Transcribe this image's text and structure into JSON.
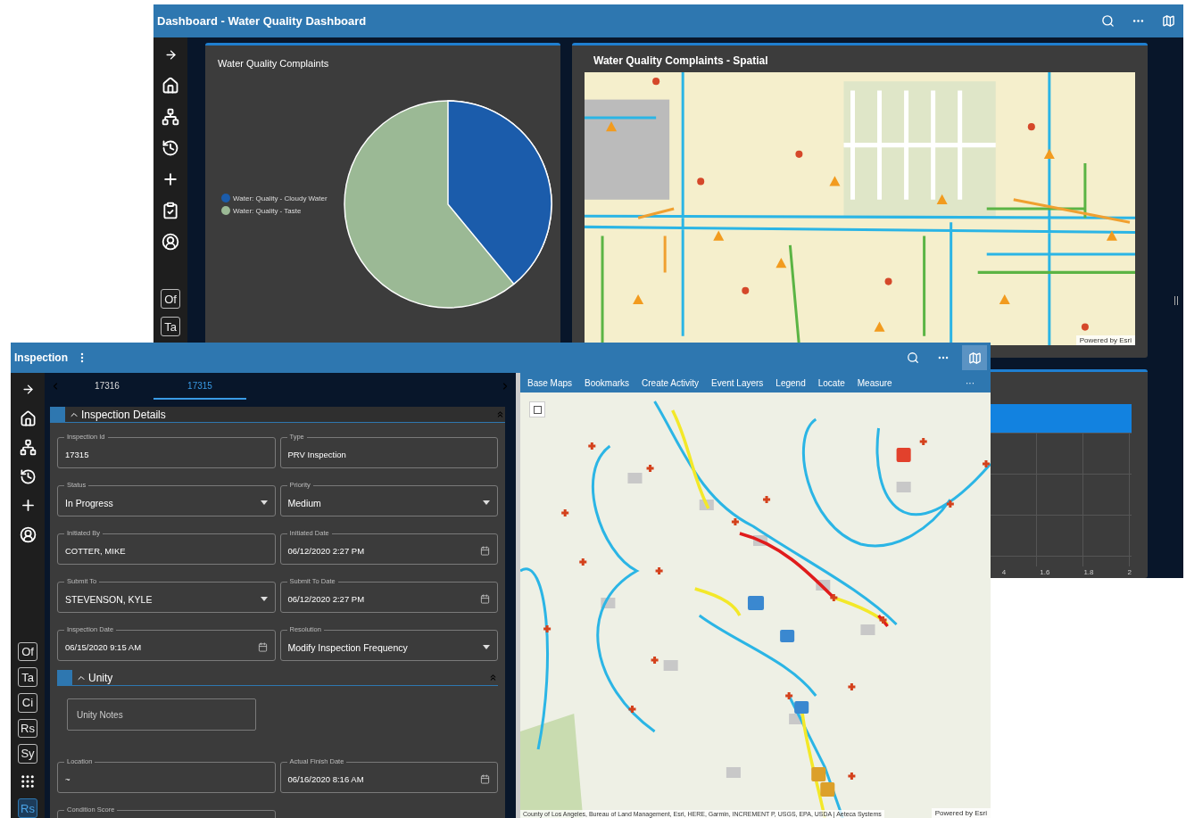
{
  "dashboard": {
    "title": "Dashboard - Water Quality Dashboard",
    "sidebar_badges": [
      "Of",
      "Ta"
    ],
    "complaints_panel": {
      "title": "Water Quality Complaints",
      "legend": [
        {
          "label": "Water: Quality - Cloudy Water",
          "color": "#1b5cab"
        },
        {
          "label": "Water: Quality - Taste",
          "color": "#9bb995"
        }
      ]
    },
    "spatial_panel": {
      "title": "Water Quality Complaints - Spatial",
      "attribution": "Powered by Esri"
    },
    "bar_panel": {
      "axis_labels": [
        "4",
        "1.6",
        "1.8",
        "2"
      ]
    }
  },
  "inspection": {
    "title": "Inspection",
    "tabs": [
      {
        "label": "17316",
        "selected": false
      },
      {
        "label": "17315",
        "selected": true
      }
    ],
    "sidebar_items": [
      {
        "kind": "badge",
        "label": "Of",
        "selected": false
      },
      {
        "kind": "badge",
        "label": "Ta",
        "selected": false
      },
      {
        "kind": "badge",
        "label": "Ci",
        "selected": false
      },
      {
        "kind": "badge",
        "label": "Rs",
        "selected": false
      },
      {
        "kind": "badge",
        "label": "Sy",
        "selected": false
      },
      {
        "kind": "apps"
      },
      {
        "kind": "badge",
        "label": "Rs",
        "selected": true
      }
    ],
    "sections": [
      {
        "title": "Inspection Details",
        "expanded": true,
        "fields": [
          {
            "label": "Inspection Id",
            "value": "17315",
            "kind": "text"
          },
          {
            "label": "Type",
            "value": "PRV Inspection",
            "kind": "text"
          },
          {
            "label": "Status",
            "value": "In Progress",
            "kind": "select"
          },
          {
            "label": "Priority",
            "value": "Medium",
            "kind": "select"
          },
          {
            "label": "Initiated By",
            "value": "COTTER, MIKE",
            "kind": "text"
          },
          {
            "label": "Initiated Date",
            "value": "06/12/2020 2:27 PM",
            "kind": "date"
          },
          {
            "label": "Submit To",
            "value": "STEVENSON, KYLE",
            "kind": "select"
          },
          {
            "label": "Submit To Date",
            "value": "06/12/2020 2:27 PM",
            "kind": "date"
          },
          {
            "label": "Inspection Date",
            "value": "06/15/2020 9:15 AM",
            "kind": "date"
          },
          {
            "label": "Resolution",
            "value": "Modify Inspection Frequency",
            "kind": "select"
          }
        ]
      },
      {
        "title": "Unity",
        "expanded": true,
        "notes_placeholder": "Unity Notes",
        "fields": [
          {
            "label": "Location",
            "value": "~",
            "kind": "text"
          },
          {
            "label": "Actual Finish Date",
            "value": "06/16/2020 8:16 AM",
            "kind": "date"
          },
          {
            "label": "Condition Score",
            "kind": "text"
          }
        ]
      }
    ],
    "map": {
      "toolbar": [
        "Base Maps",
        "Bookmarks",
        "Create Activity",
        "Event Layers",
        "Legend",
        "Locate",
        "Measure"
      ],
      "more": "···",
      "credits": "County of Los Angeles, Bureau of Land Management, Esri, HERE, Garmin, INCREMENT P, USGS, EPA, USDA | Aeteca Systems",
      "attribution": "Powered by Esri"
    }
  }
}
